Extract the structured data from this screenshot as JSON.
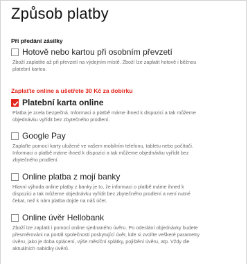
{
  "heading": "Způsob platby",
  "section_cash": "Při předání zásilky",
  "section_online": "Zaplaťte online a ušetřete 30 Kč za dobírku",
  "options": [
    {
      "label": "Hotově nebo kartou při osobním převzetí",
      "checked": false,
      "desc": [
        "Zboží zaplatíte až při převzetí na výdejním místě. Zboží lze zaplatit hotově i běžnou",
        "platební kartou."
      ]
    },
    {
      "label": "Platební karta online",
      "checked": true,
      "desc": [
        "Platba je zcela bezpečná. Informaci o platbě máme ihned k dispozici a tak můžeme",
        "objednávku vyřídit bez zbytečného prodlení."
      ]
    },
    {
      "label": "Google Pay",
      "checked": false,
      "desc": [
        "Zaplaťte pomocí karty uložené ve vašem mobilním telefonu, tabletu nebo počítači.",
        "Informaci o platbě máme ihned k dispozici a tak můžeme objednávku vyřídit bez",
        "zbytečného prodlení."
      ]
    },
    {
      "label": "Online platba z mojí banky",
      "checked": false,
      "desc": [
        "Hlavní výhoda online platby z banky je to, že informaci o platbě máme ihned k",
        "dispozici a tak můžeme objednávku vyřídit bez zbytečného prodlení a není nutné",
        "čekat, než k nám platba dojde na náš účet."
      ]
    },
    {
      "label": "Online úvěr Hellobank",
      "checked": false,
      "desc": [
        "Zboží lze zaplatit i pomocí online sjednaného úvěru. Po odeslání objednávky budete",
        "přesměrováni na portál společnosti poskytující úvěr, kde si zvolíte veškeré parametry",
        "úvěru, jako je doba splácení, výše měsíční splátky, pojištění úvěru, atp. Vždy dle",
        "aktuálních nabídky úvěrů."
      ]
    }
  ],
  "colors": {
    "accent": "#e2261c",
    "muted": "#6a6a6a",
    "border": "#cfcfcf"
  },
  "icons": {
    "checked": "checkmark-icon"
  }
}
